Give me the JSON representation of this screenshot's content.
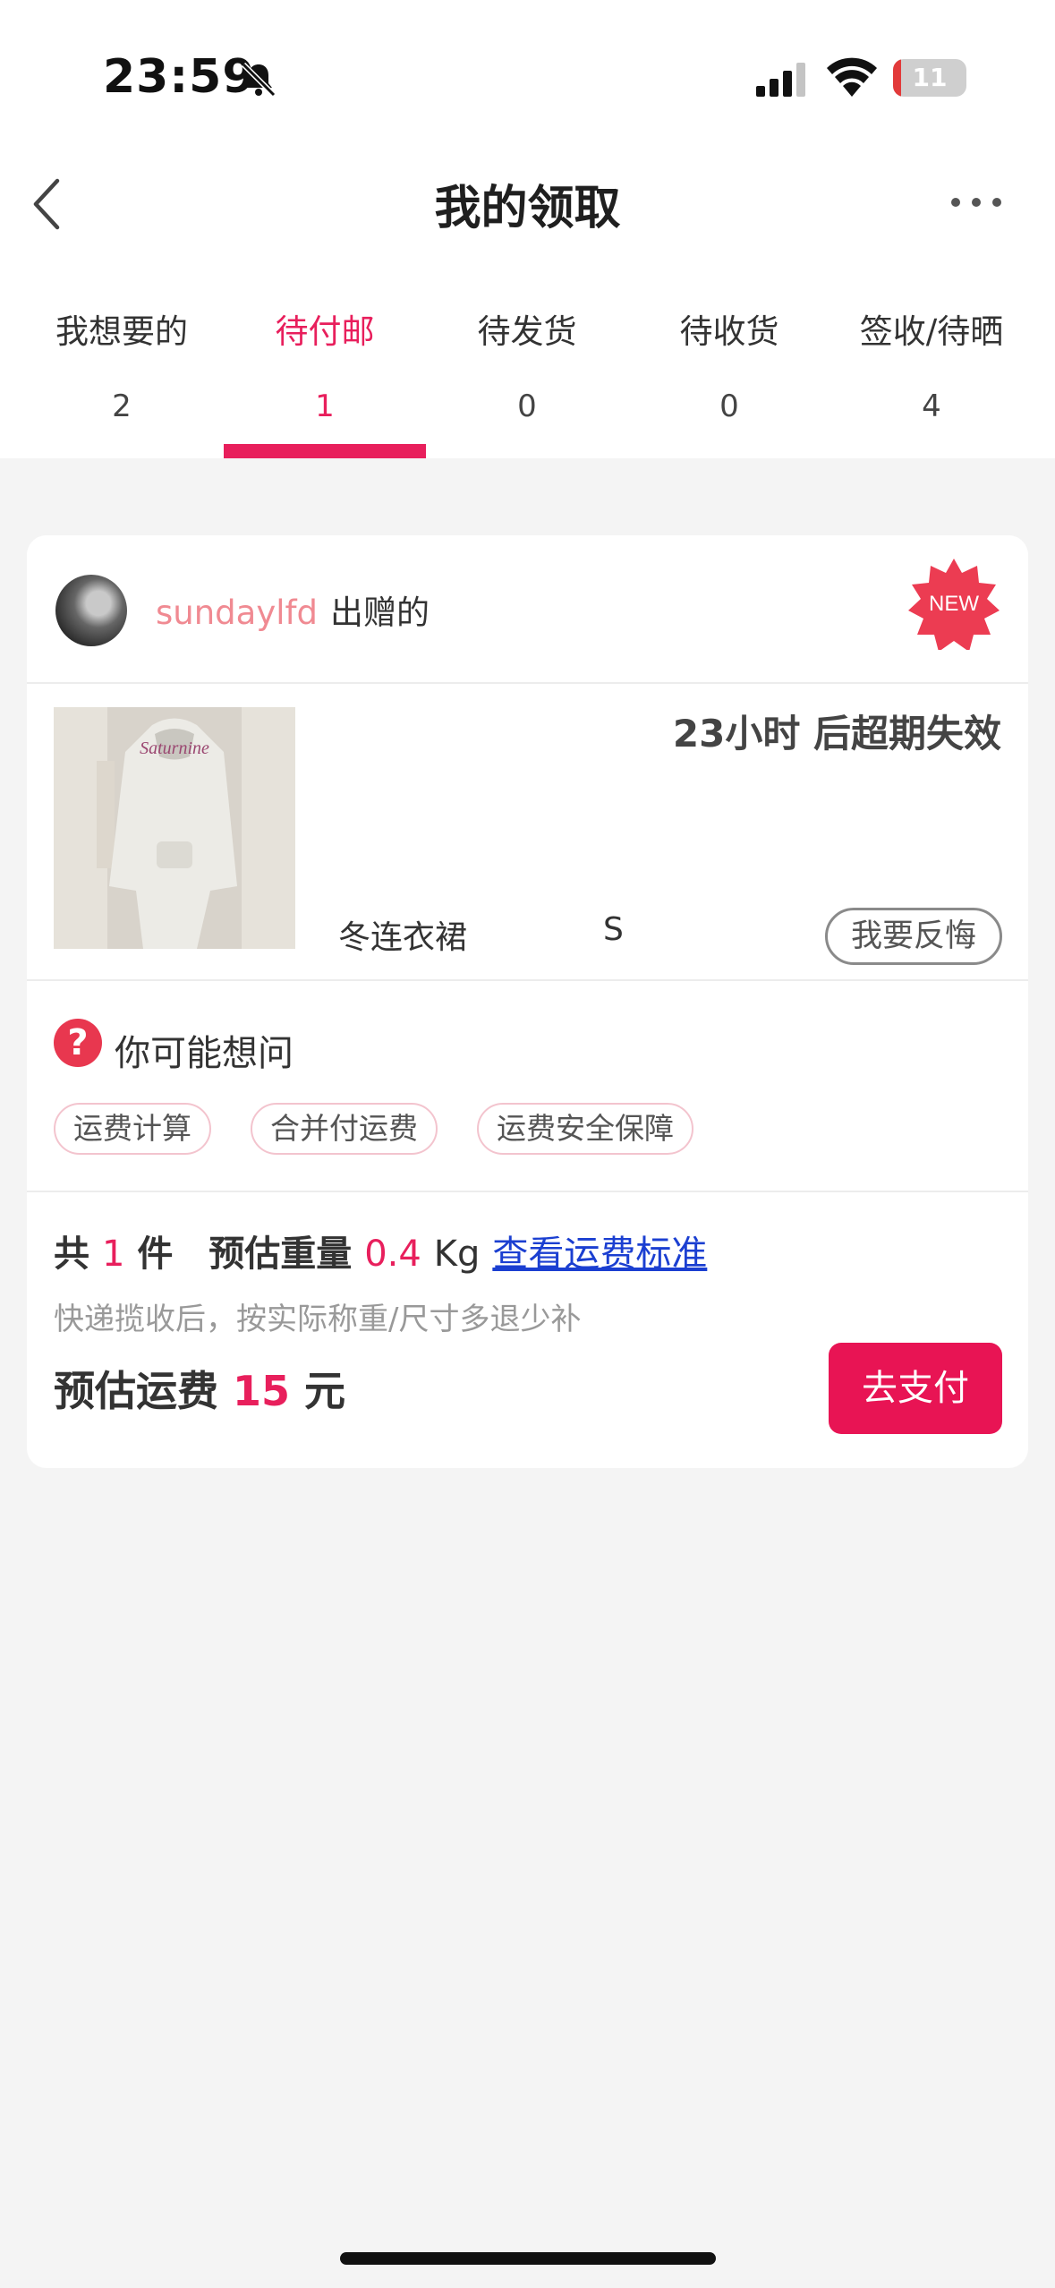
{
  "status_bar": {
    "time": "23:59",
    "battery": "11",
    "battery_level": 0.11
  },
  "nav": {
    "title": "我的领取"
  },
  "tabs": [
    {
      "label": "我想要的",
      "count": "2"
    },
    {
      "label": "待付邮",
      "count": "1",
      "active": true
    },
    {
      "label": "待发货",
      "count": "0"
    },
    {
      "label": "待收货",
      "count": "0"
    },
    {
      "label": "签收/待晒",
      "count": "4"
    }
  ],
  "card": {
    "giver_name": "sundaylfd",
    "giver_suffix": "出赠的",
    "new_badge": "NEW",
    "expiry": "23小时 后超期失效",
    "item_name": "冬连衣裙",
    "item_size": "S",
    "regret_button": "我要反悔",
    "faq_title": "你可能想问",
    "faq_chips": [
      "运费计算",
      "合并付运费",
      "运费安全保障"
    ],
    "summary": {
      "prefix": "共",
      "quantity": "1",
      "quantity_unit": "件",
      "weight_label": "预估重量",
      "weight": "0.4",
      "weight_unit": "Kg",
      "link": "查看运费标准"
    },
    "note": "快递揽收后，按实际称重/尺寸多退少补",
    "fee_label": "预估运费",
    "fee_amount": "15",
    "fee_unit": "元",
    "pay_button": "去支付"
  },
  "colors": {
    "accent": "#e81f5c",
    "link": "#1b3fd1",
    "badge": "#e8374f"
  }
}
